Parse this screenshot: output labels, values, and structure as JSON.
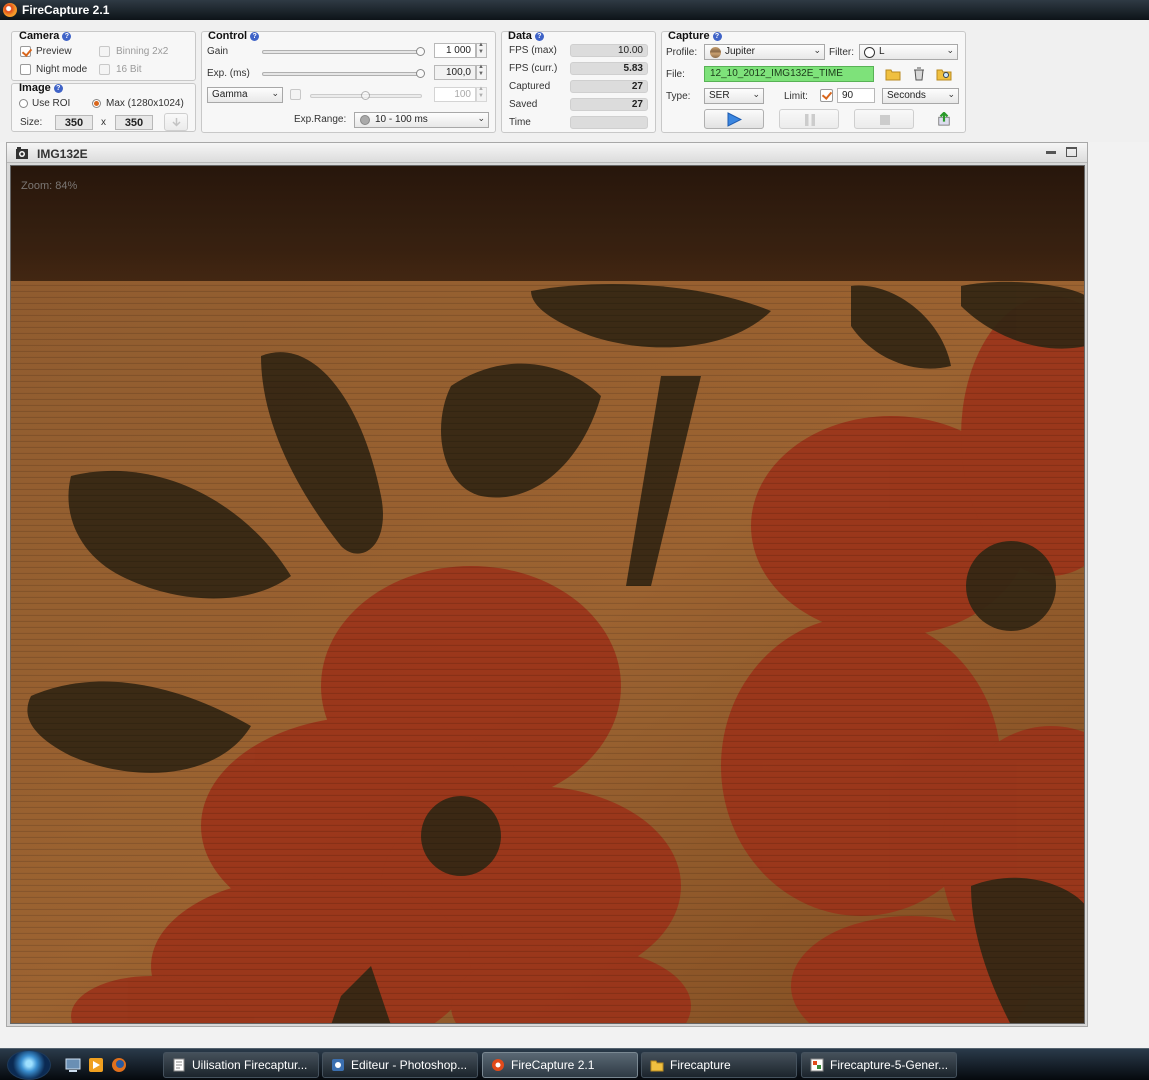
{
  "window": {
    "title": "FireCapture 2.1"
  },
  "camera": {
    "title": "Camera",
    "preview": "Preview",
    "binning": "Binning 2x2",
    "night_mode": "Night mode",
    "bit16": "16 Bit"
  },
  "image": {
    "title": "Image",
    "use_roi": "Use ROI",
    "max": "Max (1280x1024)",
    "size_label": "Size:",
    "width": "350",
    "x": "x",
    "height": "350"
  },
  "control": {
    "title": "Control",
    "gain_label": "Gain",
    "gain_value": "1 000",
    "exp_label": "Exp. (ms)",
    "exp_value": "100,0",
    "gamma_select": "Gamma",
    "gamma_value": "100",
    "exp_range_label": "Exp.Range:",
    "exp_range_value": "10 - 100 ms",
    "gain_slider_level": 1.0,
    "exp_slider_level": 1.0,
    "gamma_slider_level": 0.5
  },
  "data": {
    "title": "Data",
    "fps_max_label": "FPS (max)",
    "fps_max": "10.00",
    "fps_curr_label": "FPS (curr.)",
    "fps_curr": "5.83",
    "captured_label": "Captured",
    "captured": "27",
    "saved_label": "Saved",
    "saved": "27",
    "time_label": "Time",
    "time": ""
  },
  "capture": {
    "title": "Capture",
    "profile_label": "Profile:",
    "profile": "Jupiter",
    "filter_label": "Filter:",
    "filter": "L",
    "file_label": "File:",
    "file": "12_10_2012_IMG132E_TIME",
    "type_label": "Type:",
    "type": "SER",
    "limit_label": "Limit:",
    "limit": "90",
    "limit_unit": "Seconds"
  },
  "viewer": {
    "title": "IMG132E",
    "zoom": "Zoom: 84%"
  },
  "taskbar": {
    "tasks": [
      {
        "label": "Uilisation Firecaptur..."
      },
      {
        "label": "Editeur - Photoshop..."
      },
      {
        "label": "FireCapture 2.1"
      },
      {
        "label": "Firecapture"
      },
      {
        "label": "Firecapture-5-Gener..."
      }
    ]
  },
  "colors": {
    "accent": "#d9661c",
    "file_field": "#7ee27a",
    "help": "#3f63c7"
  }
}
